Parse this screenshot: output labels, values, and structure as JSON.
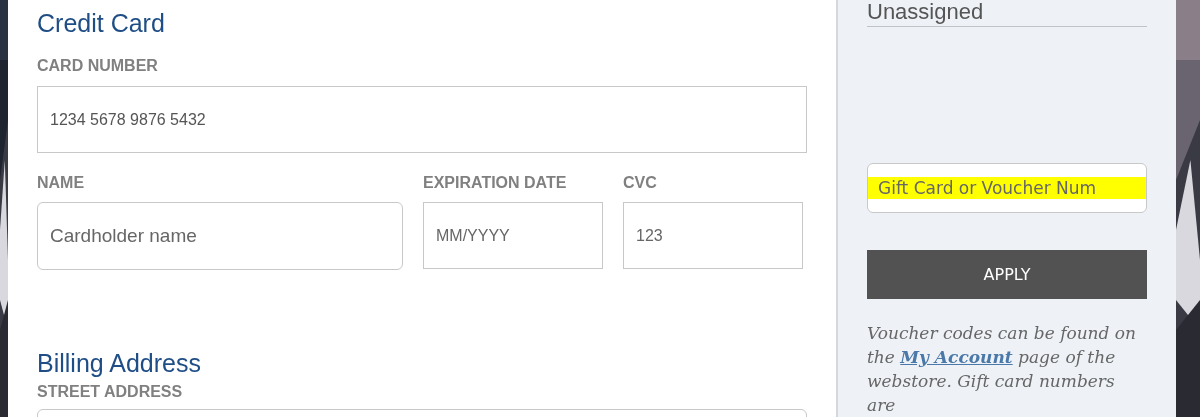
{
  "payment": {
    "title": "Credit Card",
    "card_number": {
      "label": "CARD NUMBER",
      "value": "1234 5678 9876 5432"
    },
    "name": {
      "label": "NAME",
      "placeholder": "Cardholder name"
    },
    "expiration": {
      "label": "EXPIRATION DATE",
      "placeholder": "MM/YYYY"
    },
    "cvc": {
      "label": "CVC",
      "placeholder": "123"
    }
  },
  "billing": {
    "title": "Billing Address",
    "street_label": "STREET ADDRESS"
  },
  "sidebar": {
    "assignment": "Unassigned",
    "voucher_field": {
      "placeholder": "Gift Card or Voucher Num",
      "highlighted": true
    },
    "apply_button": "APPLY",
    "note": {
      "before": "Voucher codes can be found on the",
      "link": "My Account",
      "after": "page of the webstore. Gift card numbers are"
    }
  }
}
